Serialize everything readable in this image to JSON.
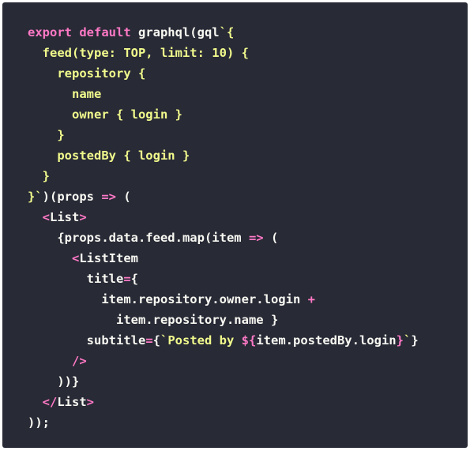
{
  "code_panel": {
    "background": "#282a36",
    "colors": {
      "keyword": "#ff79c6",
      "text": "#f8f8f2",
      "string": "#f1fa8c"
    },
    "lines": [
      [
        {
          "k": "keyword",
          "t": "export default "
        },
        {
          "k": "default",
          "t": "graphql(gql"
        },
        {
          "k": "string",
          "t": "`{"
        }
      ],
      [
        {
          "k": "string",
          "t": "  feed(type: TOP, limit: 10) {"
        }
      ],
      [
        {
          "k": "string",
          "t": "    repository {"
        }
      ],
      [
        {
          "k": "string",
          "t": "      name"
        }
      ],
      [
        {
          "k": "string",
          "t": "      owner { login }"
        }
      ],
      [
        {
          "k": "string",
          "t": "    }"
        }
      ],
      [
        {
          "k": "string",
          "t": "    postedBy { login }"
        }
      ],
      [
        {
          "k": "string",
          "t": "  }"
        }
      ],
      [
        {
          "k": "string",
          "t": "}`"
        },
        {
          "k": "default",
          "t": ")(props "
        },
        {
          "k": "keyword",
          "t": "=>"
        },
        {
          "k": "default",
          "t": " ("
        }
      ],
      [
        {
          "k": "default",
          "t": "  "
        },
        {
          "k": "keyword",
          "t": "<"
        },
        {
          "k": "default",
          "t": "List"
        },
        {
          "k": "keyword",
          "t": ">"
        }
      ],
      [
        {
          "k": "default",
          "t": "    {props.data.feed.map(item "
        },
        {
          "k": "keyword",
          "t": "=>"
        },
        {
          "k": "default",
          "t": " ("
        }
      ],
      [
        {
          "k": "default",
          "t": "      "
        },
        {
          "k": "keyword",
          "t": "<"
        },
        {
          "k": "default",
          "t": "ListItem"
        }
      ],
      [
        {
          "k": "default",
          "t": "        title"
        },
        {
          "k": "keyword",
          "t": "="
        },
        {
          "k": "default",
          "t": "{"
        }
      ],
      [
        {
          "k": "default",
          "t": "          item.repository.owner.login "
        },
        {
          "k": "keyword",
          "t": "+"
        }
      ],
      [
        {
          "k": "default",
          "t": "            item.repository.name }"
        }
      ],
      [
        {
          "k": "default",
          "t": "        subtitle"
        },
        {
          "k": "keyword",
          "t": "="
        },
        {
          "k": "default",
          "t": "{"
        },
        {
          "k": "string",
          "t": "`Posted by "
        },
        {
          "k": "keyword",
          "t": "${"
        },
        {
          "k": "default",
          "t": "item.postedBy.login"
        },
        {
          "k": "keyword",
          "t": "}"
        },
        {
          "k": "string",
          "t": "`"
        },
        {
          "k": "default",
          "t": "}"
        }
      ],
      [
        {
          "k": "default",
          "t": "      "
        },
        {
          "k": "keyword",
          "t": "/>"
        }
      ],
      [
        {
          "k": "default",
          "t": "    ))}"
        }
      ],
      [
        {
          "k": "default",
          "t": "  "
        },
        {
          "k": "keyword",
          "t": "</"
        },
        {
          "k": "default",
          "t": "List"
        },
        {
          "k": "keyword",
          "t": ">"
        }
      ],
      [
        {
          "k": "default",
          "t": "));"
        }
      ]
    ]
  }
}
